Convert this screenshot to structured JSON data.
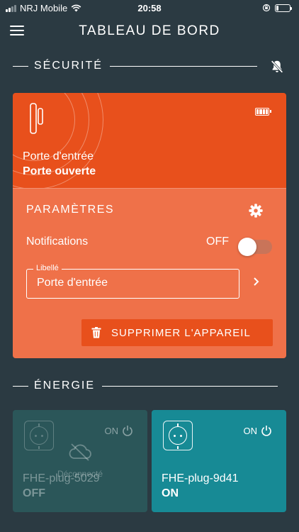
{
  "status_bar": {
    "carrier": "NRJ Mobile",
    "time": "20:58",
    "battery_pct": 0.15
  },
  "header": {
    "title": "TABLEAU DE BORD",
    "menu_icon": "menu-icon"
  },
  "security": {
    "title": "SÉCURITÉ",
    "mute_icon": "bell-off-icon",
    "device": {
      "icon": "door-sensor-icon",
      "name": "Porte d'entrée",
      "state": "Porte ouverte",
      "battery_icon": "battery-full-icon"
    },
    "params": {
      "title": "PARAMÈTRES",
      "notifications_label": "Notifications",
      "notifications_state": "OFF",
      "notifications_on": false,
      "field_label": "Libellé",
      "field_value": "Porte d'entrée",
      "delete_label": "SUPPRIMER L'APPAREIL"
    },
    "colors": {
      "card_top": "#e8501c",
      "card_bottom": "#ef7149"
    }
  },
  "energy": {
    "title": "ÉNERGIE",
    "plugs": [
      {
        "name": "FHE-plug-5029",
        "power_label": "ON",
        "state": "OFF",
        "status": "Déconnecté",
        "connected": false
      },
      {
        "name": "FHE-plug-9d41",
        "power_label": "ON",
        "state": "ON",
        "connected": true
      }
    ],
    "colors": {
      "plug_on": "#178a95",
      "plug_off": "#2b5659"
    }
  }
}
